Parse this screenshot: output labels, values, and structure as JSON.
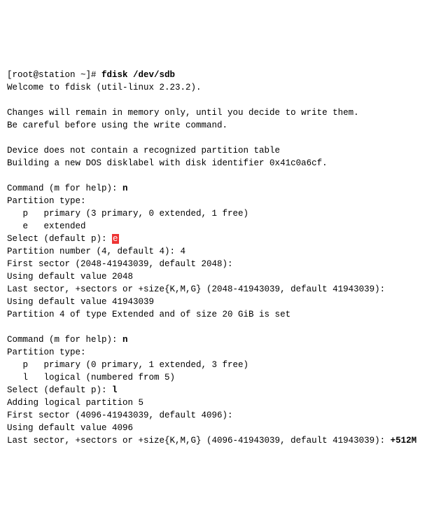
{
  "prompt_line": {
    "prompt": "[root@station ~]# ",
    "command": "fdisk /dev/sdb"
  },
  "welcome": "Welcome to fdisk (util-linux 2.23.2).",
  "blank": "",
  "change_notice_1": "Changes will remain in memory only, until you decide to write them.",
  "change_notice_2": "Be careful before using the write command.",
  "no_table": "Device does not contain a recognized partition table",
  "new_label": "Building a new DOS disklabel with disk identifier 0x41c0a6cf.",
  "cmd1": {
    "prompt": "Command (m for help): ",
    "input": "n"
  },
  "ptype_header": "Partition type:",
  "ptype_p1": "   p   primary (3 primary, 0 extended, 1 free)",
  "ptype_e1": "   e   extended",
  "select1": {
    "prompt": "Select (default p): ",
    "input": "e"
  },
  "partnum": "Partition number (4, default 4): 4",
  "first1": "First sector (2048-41943039, default 2048):",
  "usedef1": "Using default value 2048",
  "last1": "Last sector, +sectors or +size{K,M,G} (2048-41943039, default 41943039):",
  "usedef2": "Using default value 41943039",
  "setmsg": "Partition 4 of type Extended and of size 20 GiB is set",
  "cmd2": {
    "prompt": "Command (m for help): ",
    "input": "n"
  },
  "ptype_header2": "Partition type:",
  "ptype_p2": "   p   primary (0 primary, 1 extended, 3 free)",
  "ptype_l2": "   l   logical (numbered from 5)",
  "select2": {
    "prompt": "Select (default p): ",
    "input": "l"
  },
  "addlog": "Adding logical partition 5",
  "first2": "First sector (4096-41943039, default 4096):",
  "usedef3": "Using default value 4096",
  "lastcut": {
    "prefix": "Last sector, +sectors or +size{K,M,G} (4096-41943039, default 41943039): ",
    "input": "+512M"
  }
}
